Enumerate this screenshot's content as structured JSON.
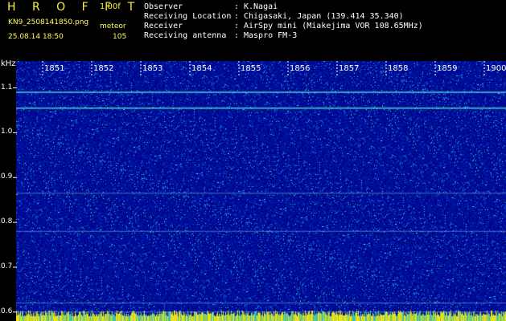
{
  "header": {
    "brand": "H R O F F T",
    "version": "1.00f",
    "filename": "KN9_2508141850.png",
    "mode": "meteor",
    "datetime": "25.08.14 18:50",
    "count": "105"
  },
  "info": [
    {
      "key": "Observer",
      "sep": ":",
      "value": "K.Nagai"
    },
    {
      "key": "Receiving Location",
      "sep": ":",
      "value": "Chigasaki, Japan (139.414 35.340)"
    },
    {
      "key": "Receiver",
      "sep": ":",
      "value": "AirSpy mini (Miakejima VOR 108.65MHz)"
    },
    {
      "key": "Receiving antenna",
      "sep": ":",
      "value": "Maspro FM-3"
    }
  ],
  "colors": {
    "accent": "#f6f13a",
    "background": "#000000",
    "spectrogram_base": "#000a90"
  },
  "chart_data": {
    "type": "heatmap",
    "ylabel": "kHz",
    "y_ticks": [
      "1.1",
      "1.0",
      "0.9",
      "0.8",
      "0.7",
      "0.6"
    ],
    "y_tick_values": [
      1.1,
      1.0,
      0.9,
      0.8,
      0.7,
      0.6
    ],
    "x_ticks": [
      "1851",
      "1852",
      "1853",
      "1854",
      "1855",
      "1856",
      "1857",
      "1858",
      "1859",
      "1900"
    ],
    "ylim": [
      0.58,
      1.16
    ],
    "xlim": [
      "18:50",
      "19:00"
    ],
    "horizontal_lines_khz": [
      1.09,
      1.055,
      0.865,
      0.78,
      0.62,
      0.6
    ]
  }
}
